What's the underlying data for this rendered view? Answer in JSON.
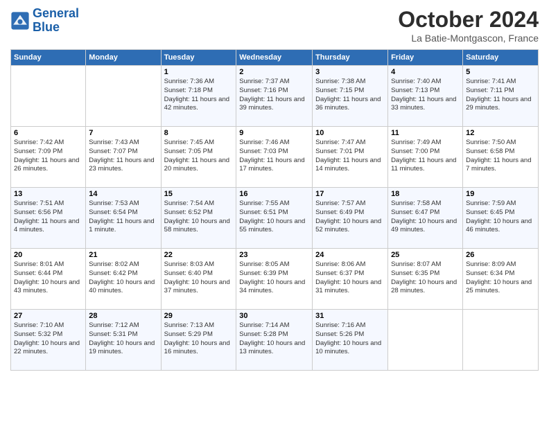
{
  "header": {
    "logo_line1": "General",
    "logo_line2": "Blue",
    "title": "October 2024",
    "location": "La Batie-Montgascon, France"
  },
  "days_of_week": [
    "Sunday",
    "Monday",
    "Tuesday",
    "Wednesday",
    "Thursday",
    "Friday",
    "Saturday"
  ],
  "weeks": [
    [
      {
        "day": "",
        "info": ""
      },
      {
        "day": "",
        "info": ""
      },
      {
        "day": "1",
        "info": "Sunrise: 7:36 AM\nSunset: 7:18 PM\nDaylight: 11 hours and 42 minutes."
      },
      {
        "day": "2",
        "info": "Sunrise: 7:37 AM\nSunset: 7:16 PM\nDaylight: 11 hours and 39 minutes."
      },
      {
        "day": "3",
        "info": "Sunrise: 7:38 AM\nSunset: 7:15 PM\nDaylight: 11 hours and 36 minutes."
      },
      {
        "day": "4",
        "info": "Sunrise: 7:40 AM\nSunset: 7:13 PM\nDaylight: 11 hours and 33 minutes."
      },
      {
        "day": "5",
        "info": "Sunrise: 7:41 AM\nSunset: 7:11 PM\nDaylight: 11 hours and 29 minutes."
      }
    ],
    [
      {
        "day": "6",
        "info": "Sunrise: 7:42 AM\nSunset: 7:09 PM\nDaylight: 11 hours and 26 minutes."
      },
      {
        "day": "7",
        "info": "Sunrise: 7:43 AM\nSunset: 7:07 PM\nDaylight: 11 hours and 23 minutes."
      },
      {
        "day": "8",
        "info": "Sunrise: 7:45 AM\nSunset: 7:05 PM\nDaylight: 11 hours and 20 minutes."
      },
      {
        "day": "9",
        "info": "Sunrise: 7:46 AM\nSunset: 7:03 PM\nDaylight: 11 hours and 17 minutes."
      },
      {
        "day": "10",
        "info": "Sunrise: 7:47 AM\nSunset: 7:01 PM\nDaylight: 11 hours and 14 minutes."
      },
      {
        "day": "11",
        "info": "Sunrise: 7:49 AM\nSunset: 7:00 PM\nDaylight: 11 hours and 11 minutes."
      },
      {
        "day": "12",
        "info": "Sunrise: 7:50 AM\nSunset: 6:58 PM\nDaylight: 11 hours and 7 minutes."
      }
    ],
    [
      {
        "day": "13",
        "info": "Sunrise: 7:51 AM\nSunset: 6:56 PM\nDaylight: 11 hours and 4 minutes."
      },
      {
        "day": "14",
        "info": "Sunrise: 7:53 AM\nSunset: 6:54 PM\nDaylight: 11 hours and 1 minute."
      },
      {
        "day": "15",
        "info": "Sunrise: 7:54 AM\nSunset: 6:52 PM\nDaylight: 10 hours and 58 minutes."
      },
      {
        "day": "16",
        "info": "Sunrise: 7:55 AM\nSunset: 6:51 PM\nDaylight: 10 hours and 55 minutes."
      },
      {
        "day": "17",
        "info": "Sunrise: 7:57 AM\nSunset: 6:49 PM\nDaylight: 10 hours and 52 minutes."
      },
      {
        "day": "18",
        "info": "Sunrise: 7:58 AM\nSunset: 6:47 PM\nDaylight: 10 hours and 49 minutes."
      },
      {
        "day": "19",
        "info": "Sunrise: 7:59 AM\nSunset: 6:45 PM\nDaylight: 10 hours and 46 minutes."
      }
    ],
    [
      {
        "day": "20",
        "info": "Sunrise: 8:01 AM\nSunset: 6:44 PM\nDaylight: 10 hours and 43 minutes."
      },
      {
        "day": "21",
        "info": "Sunrise: 8:02 AM\nSunset: 6:42 PM\nDaylight: 10 hours and 40 minutes."
      },
      {
        "day": "22",
        "info": "Sunrise: 8:03 AM\nSunset: 6:40 PM\nDaylight: 10 hours and 37 minutes."
      },
      {
        "day": "23",
        "info": "Sunrise: 8:05 AM\nSunset: 6:39 PM\nDaylight: 10 hours and 34 minutes."
      },
      {
        "day": "24",
        "info": "Sunrise: 8:06 AM\nSunset: 6:37 PM\nDaylight: 10 hours and 31 minutes."
      },
      {
        "day": "25",
        "info": "Sunrise: 8:07 AM\nSunset: 6:35 PM\nDaylight: 10 hours and 28 minutes."
      },
      {
        "day": "26",
        "info": "Sunrise: 8:09 AM\nSunset: 6:34 PM\nDaylight: 10 hours and 25 minutes."
      }
    ],
    [
      {
        "day": "27",
        "info": "Sunrise: 7:10 AM\nSunset: 5:32 PM\nDaylight: 10 hours and 22 minutes."
      },
      {
        "day": "28",
        "info": "Sunrise: 7:12 AM\nSunset: 5:31 PM\nDaylight: 10 hours and 19 minutes."
      },
      {
        "day": "29",
        "info": "Sunrise: 7:13 AM\nSunset: 5:29 PM\nDaylight: 10 hours and 16 minutes."
      },
      {
        "day": "30",
        "info": "Sunrise: 7:14 AM\nSunset: 5:28 PM\nDaylight: 10 hours and 13 minutes."
      },
      {
        "day": "31",
        "info": "Sunrise: 7:16 AM\nSunset: 5:26 PM\nDaylight: 10 hours and 10 minutes."
      },
      {
        "day": "",
        "info": ""
      },
      {
        "day": "",
        "info": ""
      }
    ]
  ]
}
